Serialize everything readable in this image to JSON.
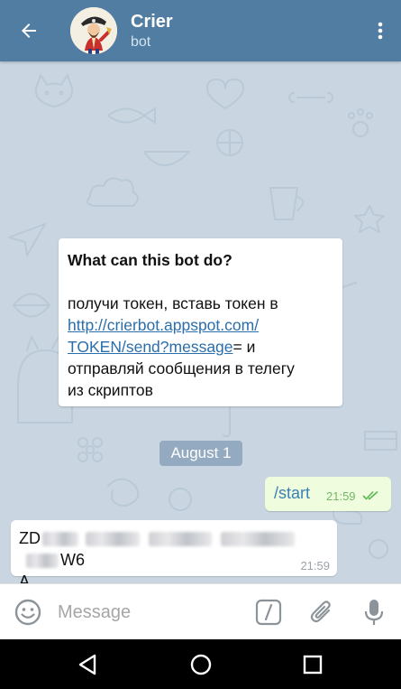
{
  "header": {
    "back_icon": "arrow-left-icon",
    "title": "Crier",
    "subtitle": "bot",
    "menu_icon": "more-vertical-icon",
    "bg_color": "#517da2"
  },
  "bot_info": {
    "heading": "What can this bot do?",
    "text_before": "получи токен, вставь токен в",
    "link_line1": "http://crierbot.appspot.com/",
    "link_line2": "TOKEN/send?message",
    "text_after_1": "= и",
    "text_after_2": "отправляй сообщения в телегу",
    "text_after_3": "из скриптов"
  },
  "date_separator": "August 1",
  "messages": {
    "outgoing": {
      "text": "/start",
      "time": "21:59",
      "status_icon": "double-check-icon"
    },
    "incoming": {
      "line1_start": "ZD",
      "line1_end": "W6",
      "line2": "A",
      "time": "21:59"
    }
  },
  "composer": {
    "placeholder": "Message",
    "emoji_icon": "emoji-icon",
    "command_icon": "slash-command-icon",
    "attach_icon": "paperclip-icon",
    "mic_icon": "microphone-icon"
  },
  "navbar": {
    "back_icon": "nav-back-icon",
    "home_icon": "nav-home-icon",
    "recents_icon": "nav-recents-icon"
  }
}
